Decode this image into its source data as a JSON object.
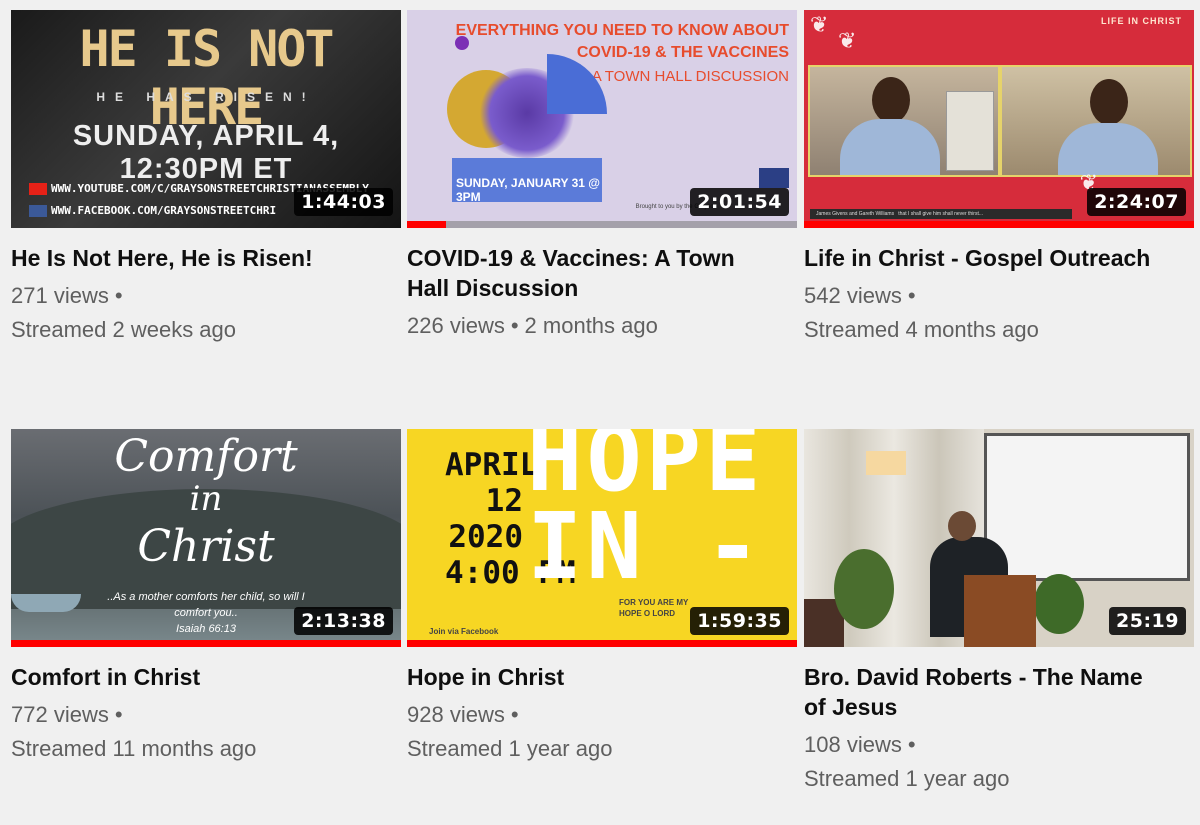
{
  "videos": [
    {
      "title": "He Is Not Here, He is Risen!",
      "duration": "1:44:03",
      "views": "271 views",
      "dot": "•",
      "date": "Streamed 2 weeks ago",
      "progress": 0,
      "thumb": {
        "headline": "HE IS NOT HERE",
        "subline": "HE HAS RISEN!",
        "date_line": "SUNDAY, APRIL 4, 12:30PM ET",
        "link1": "WWW.YOUTUBE.COM/C/GRAYSONSTREETCHRISTIANASSEMBLY",
        "link2": "WWW.FACEBOOK.COM/GRAYSONSTREETCHRI"
      }
    },
    {
      "title": "COVID-19 & Vaccines: A Town Hall Discussion",
      "duration": "2:01:54",
      "views": "226 views",
      "dot": "•",
      "date": "2 months ago",
      "progress": 0.1,
      "thumb": {
        "headline1": "EVERYTHING YOU NEED TO KNOW ABOUT",
        "headline2": "COVID-19 & THE VACCINES",
        "subline": "A TOWN HALL DISCUSSION",
        "band": "SUNDAY, JANUARY 31 @ 3PM",
        "credit": "Brought to you by the Grayson"
      }
    },
    {
      "title": "Life in Christ - Gospel Outreach",
      "duration": "2:24:07",
      "views": "542 views",
      "dot": "•",
      "date": "Streamed 4 months ago",
      "progress": 1.0,
      "thumb": {
        "corner": "LIFE IN CHRIST",
        "caption": "James Givens and Gareth Williams",
        "verse_cap": "that I shall give him shall never thirst..."
      }
    },
    {
      "title": "Comfort in Christ",
      "duration": "2:13:38",
      "views": "772 views",
      "dot": "•",
      "date": "Streamed 11 months ago",
      "progress": 1.0,
      "thumb": {
        "script1": "Comfort",
        "script2": "in",
        "script3": "Christ",
        "verse1": "..As a mother comforts her child, so will I",
        "verse2": "comfort you..",
        "verse3": "Isaiah 66:13"
      }
    },
    {
      "title": "Hope in Christ",
      "duration": "1:59:35",
      "views": "928 views",
      "dot": "•",
      "date": "Streamed 1 year ago",
      "progress": 1.0,
      "thumb": {
        "date1": "APRIL",
        "date2": "12",
        "date3": "2020",
        "date4": "4:00 PM",
        "big": "HOPE IN -",
        "small": "FOR YOU ARE MY HOPE O LORD",
        "fb": "Join via Facebook"
      }
    },
    {
      "title": "Bro. David Roberts - The Name of Jesus",
      "duration": "25:19",
      "views": "108 views",
      "dot": "•",
      "date": "Streamed 1 year ago",
      "progress": 0,
      "thumb": {}
    }
  ],
  "colors": {
    "progress": "#ff0000",
    "background": "#f0f0f0",
    "meta_text": "#5f5f5f"
  }
}
